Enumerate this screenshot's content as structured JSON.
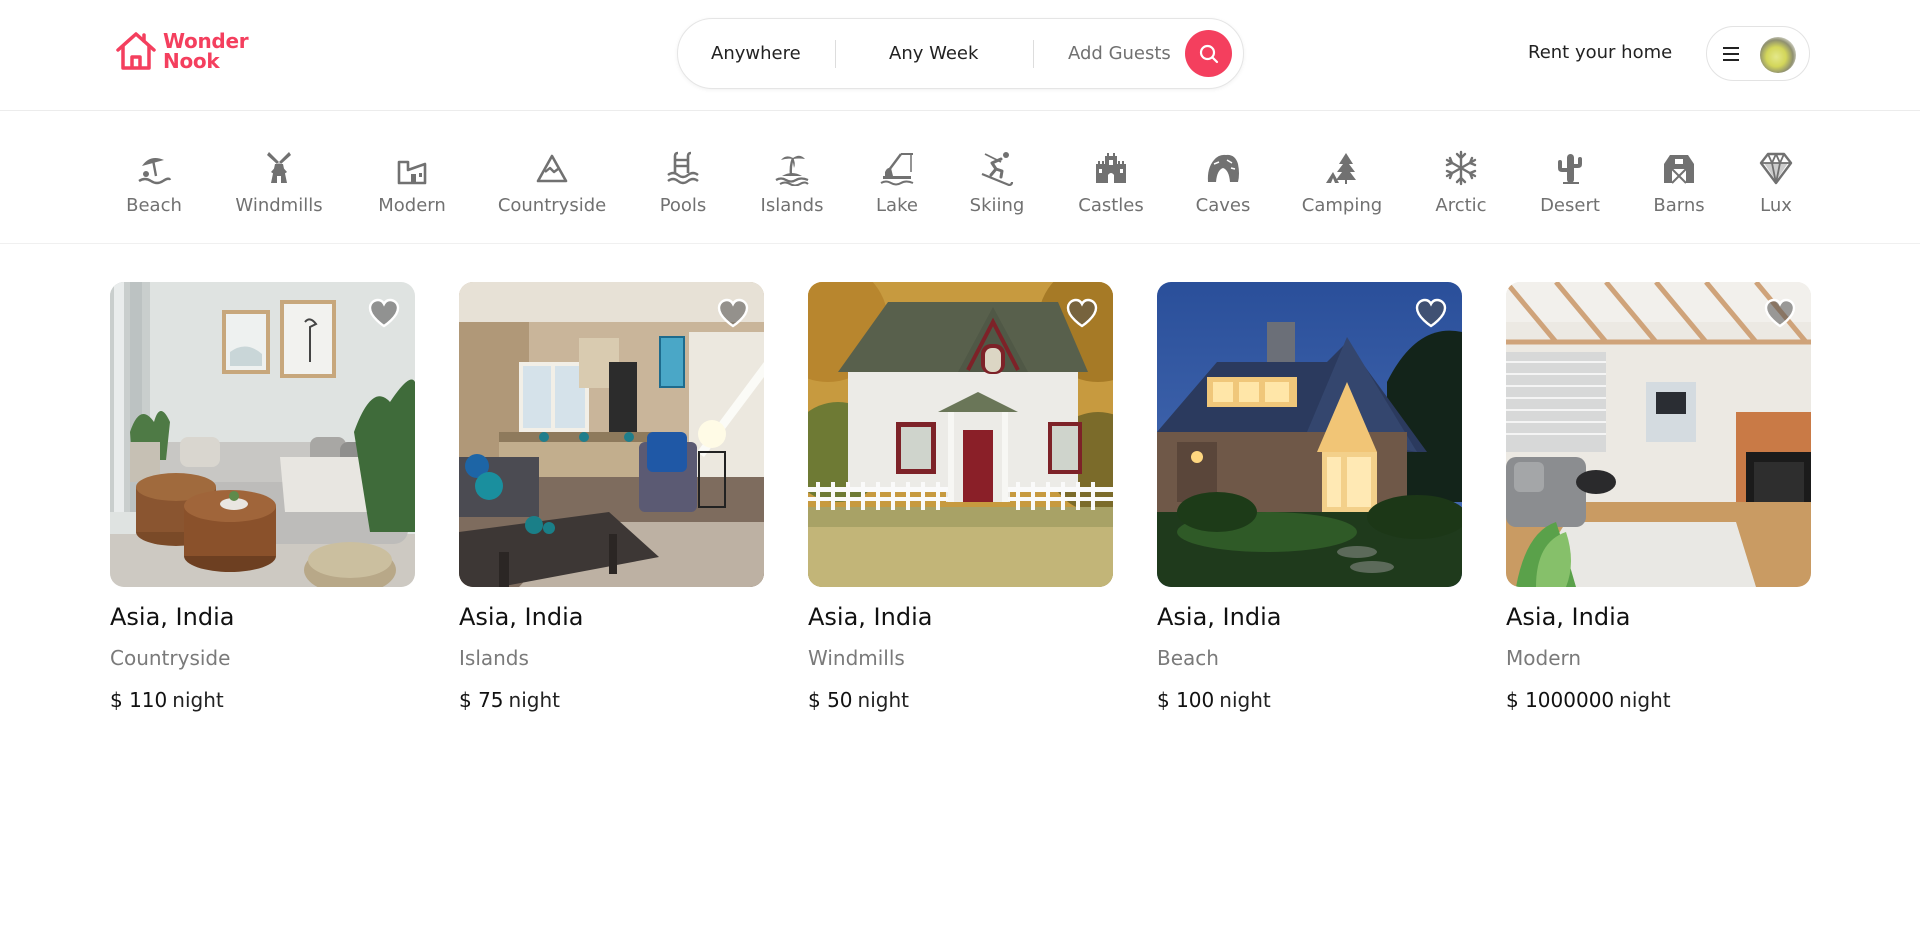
{
  "brand": {
    "line1": "Wonder",
    "line2": "Nook",
    "color": "#f43f5e"
  },
  "search": {
    "where": "Anywhere",
    "week": "Any Week",
    "guests": "Add Guests",
    "button_icon": "search-icon"
  },
  "nav": {
    "rent_label": "Rent your home",
    "menu_icon": "menu-icon"
  },
  "categories": [
    {
      "label": "Beach",
      "icon": "beach-icon"
    },
    {
      "label": "Windmills",
      "icon": "windmill-icon"
    },
    {
      "label": "Modern",
      "icon": "modern-icon"
    },
    {
      "label": "Countryside",
      "icon": "mountain-icon"
    },
    {
      "label": "Pools",
      "icon": "pool-icon"
    },
    {
      "label": "Islands",
      "icon": "island-icon"
    },
    {
      "label": "Lake",
      "icon": "lake-icon"
    },
    {
      "label": "Skiing",
      "icon": "skiing-icon"
    },
    {
      "label": "Castles",
      "icon": "castle-icon"
    },
    {
      "label": "Caves",
      "icon": "cave-icon"
    },
    {
      "label": "Camping",
      "icon": "camping-icon"
    },
    {
      "label": "Arctic",
      "icon": "snowflake-icon"
    },
    {
      "label": "Desert",
      "icon": "cactus-icon"
    },
    {
      "label": "Barns",
      "icon": "barn-icon"
    },
    {
      "label": "Lux",
      "icon": "diamond-icon"
    }
  ],
  "listings": [
    {
      "location": "Asia, India",
      "category": "Countryside",
      "price": "$ 110",
      "unit": "night"
    },
    {
      "location": "Asia, India",
      "category": "Islands",
      "price": "$ 75",
      "unit": "night"
    },
    {
      "location": "Asia, India",
      "category": "Windmills",
      "price": "$ 50",
      "unit": "night"
    },
    {
      "location": "Asia, India",
      "category": "Beach",
      "price": "$ 100",
      "unit": "night"
    },
    {
      "location": "Asia, India",
      "category": "Modern",
      "price": "$ 1000000",
      "unit": "night"
    }
  ]
}
